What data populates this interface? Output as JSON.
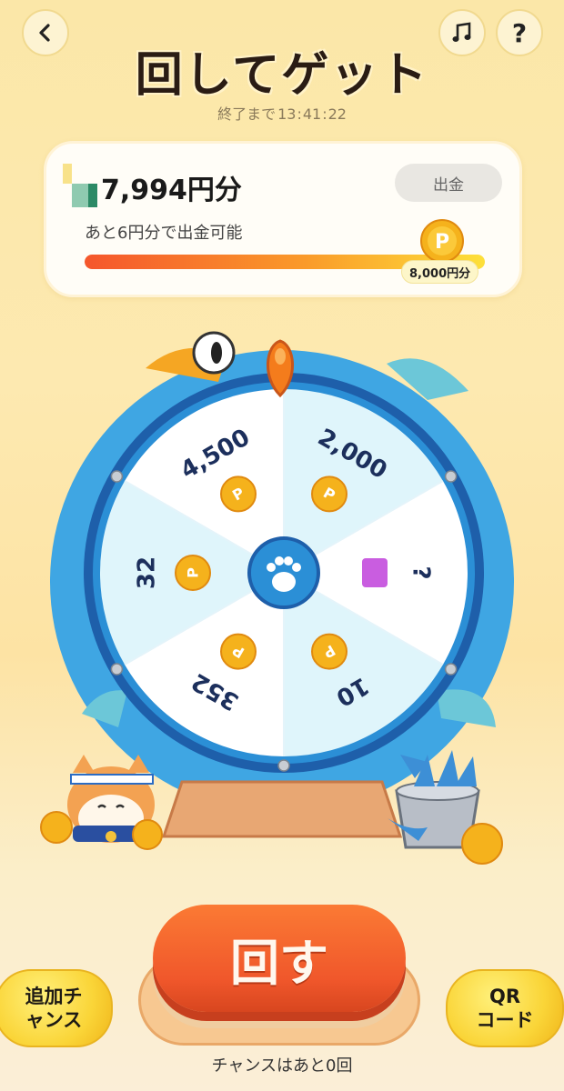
{
  "header": {
    "title": "回してゲット",
    "countdown_prefix": "終了まで",
    "countdown_h": "13",
    "countdown_m": "41",
    "countdown_s": "22",
    "back_icon": "chevron-left-icon",
    "music_icon": "music-note-icon",
    "help_icon": "question-icon"
  },
  "balance": {
    "amount": "7,994円分",
    "withdraw_label": "出金",
    "progress_message": "あと6円分で出金可能",
    "progress_fraction": 0.999,
    "goal_label": "8,000円分"
  },
  "wheel": {
    "segments": [
      {
        "label": "4,500",
        "color": "#ffffff"
      },
      {
        "label": "2,000",
        "color": "#dff5fb"
      },
      {
        "label": "?",
        "color": "#ffffff"
      },
      {
        "label": "10",
        "color": "#dff5fb"
      },
      {
        "label": "352",
        "color": "#ffffff"
      },
      {
        "label": "32",
        "color": "#dff5fb"
      }
    ],
    "coin_letter": "P"
  },
  "actions": {
    "spin_label": "回す",
    "extra_chance_line1": "追加チ",
    "extra_chance_line2": "ャンス",
    "qr_line1": "QR",
    "qr_line2": "コード",
    "chances_remaining": "チャンスはあと0回"
  },
  "colors": {
    "accent": "#f0572b",
    "wheel_rim": "#2b8fd6",
    "coin": "#f5b21c"
  }
}
